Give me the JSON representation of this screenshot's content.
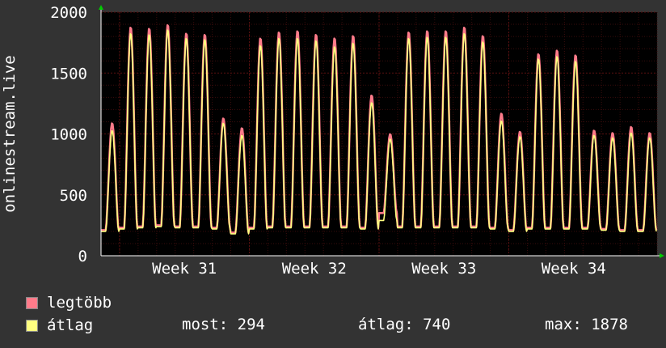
{
  "chart_data": {
    "type": "line",
    "ylabel": "onlinestream.live",
    "ylim": [
      0,
      2000
    ],
    "yticks": [
      0,
      500,
      1000,
      1500,
      2000
    ],
    "xticks": [
      "Week 31",
      "Week 32",
      "Week 33",
      "Week 34"
    ],
    "grid": true,
    "colors": {
      "background": "#333333",
      "plot_bg": "#000000",
      "grid": "#5a1010",
      "axis": "#ffffff",
      "arrow": "#00cc00"
    },
    "series": [
      {
        "name": "legtöbb",
        "color": "#ff7b8a",
        "daily_peaks": [
          1090,
          1880,
          1870,
          1900,
          1830,
          1820,
          1130,
          1050,
          1790,
          1840,
          1850,
          1820,
          1790,
          1810,
          1320,
          1000,
          1840,
          1850,
          1850,
          1880,
          1810,
          1170,
          1020,
          1660,
          1690,
          1650,
          1030,
          1010,
          1060,
          1010
        ],
        "daily_mins": [
          210,
          230,
          240,
          250,
          240,
          240,
          230,
          190,
          230,
          240,
          240,
          240,
          240,
          240,
          230,
          350,
          240,
          240,
          240,
          240,
          240,
          230,
          210,
          230,
          230,
          230,
          230,
          220,
          210,
          210
        ]
      },
      {
        "name": "átlag",
        "color": "#ffff80",
        "daily_peaks": [
          1030,
          1830,
          1820,
          1860,
          1790,
          1780,
          1090,
          990,
          1730,
          1790,
          1790,
          1770,
          1720,
          1750,
          1260,
          960,
          1790,
          1800,
          1800,
          1830,
          1760,
          1110,
          980,
          1620,
          1640,
          1600,
          990,
          970,
          1010,
          970
        ],
        "daily_mins": [
          200,
          220,
          230,
          240,
          230,
          230,
          220,
          180,
          220,
          230,
          230,
          230,
          230,
          230,
          220,
          290,
          230,
          230,
          230,
          230,
          230,
          220,
          200,
          220,
          220,
          220,
          220,
          210,
          200,
          200
        ]
      }
    ]
  },
  "legend": [
    {
      "label": "legtöbb",
      "color": "#ff7b8a"
    },
    {
      "label": "átlag",
      "color": "#ffff80"
    }
  ],
  "stats": {
    "most": "most: 294",
    "atlag": "átlag: 740",
    "max": "max: 1878"
  }
}
